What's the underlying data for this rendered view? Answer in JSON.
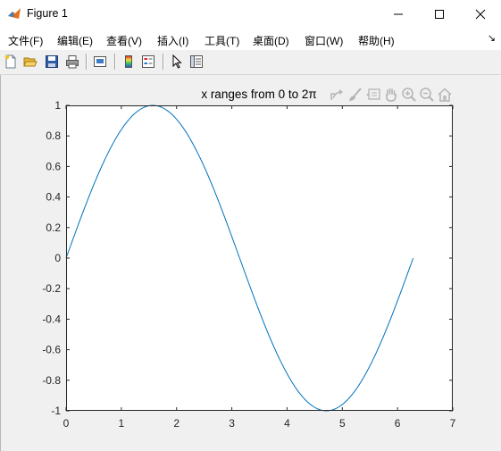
{
  "window": {
    "title": "Figure 1"
  },
  "menu": {
    "items": [
      "文件(F)",
      "编辑(E)",
      "查看(V)",
      "插入(I)",
      "工具(T)",
      "桌面(D)",
      "窗口(W)",
      "帮助(H)"
    ],
    "overflow_glyph": "↘"
  },
  "toolbar": {
    "buttons": [
      "new-figure-icon",
      "open-file-icon",
      "save-icon",
      "print-icon",
      "link-plot-icon",
      "colorbar-icon",
      "legend-icon",
      "pointer-icon",
      "property-inspector-icon"
    ]
  },
  "axes_toolbar": {
    "buttons": [
      "export-icon",
      "brush-icon",
      "data-tips-icon",
      "pan-icon",
      "zoom-in-icon",
      "zoom-out-icon",
      "home-icon"
    ]
  },
  "colors": {
    "line": "#0072bd",
    "axes_background": "#ffffff",
    "figure_background": "#f0f0f0"
  },
  "chart_data": {
    "type": "line",
    "title": "x ranges from 0 to 2π",
    "xlabel": "",
    "ylabel": "",
    "xlim": [
      0,
      7
    ],
    "ylim": [
      -1,
      1
    ],
    "xticks": [
      "0",
      "1",
      "2",
      "3",
      "4",
      "5",
      "6",
      "7"
    ],
    "yticks": [
      "-1",
      "-0.8",
      "-0.6",
      "-0.4",
      "-0.2",
      "0",
      "0.2",
      "0.4",
      "0.6",
      "0.8",
      "1"
    ],
    "grid": false,
    "series": [
      {
        "function": "y = sin(x)",
        "x": [
          0,
          0.3,
          0.6,
          0.9,
          1.2,
          1.5,
          1.5708,
          1.8,
          2.1,
          2.4,
          2.7,
          3.0,
          3.1416,
          3.3,
          3.6,
          3.9,
          4.2,
          4.5,
          4.7124,
          4.8,
          5.1,
          5.4,
          5.7,
          6.0,
          6.2832
        ],
        "y": [
          0,
          0.296,
          0.565,
          0.783,
          0.932,
          0.997,
          1.0,
          0.974,
          0.863,
          0.675,
          0.427,
          0.141,
          0,
          -0.158,
          -0.443,
          -0.688,
          -0.872,
          -0.978,
          -1.0,
          -0.996,
          -0.926,
          -0.773,
          -0.551,
          -0.279,
          0
        ]
      }
    ]
  }
}
